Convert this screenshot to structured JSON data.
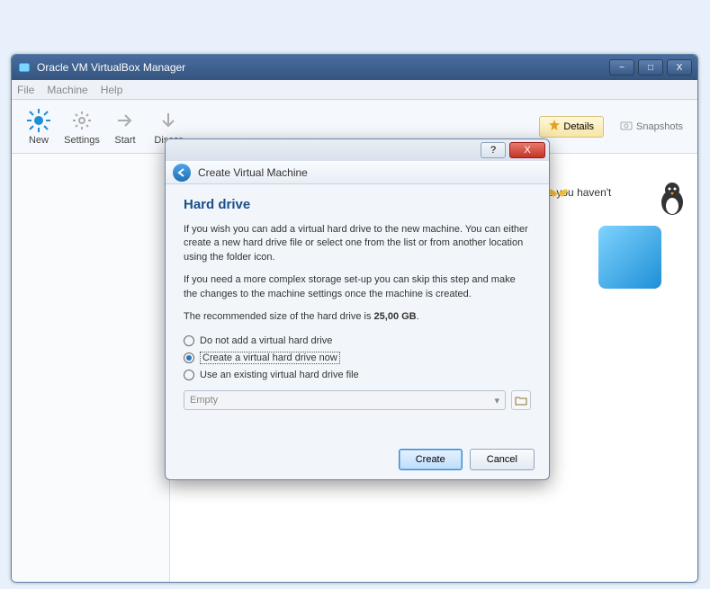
{
  "window": {
    "title": "Oracle VM VirtualBox Manager",
    "min_label": "−",
    "max_label": "□",
    "close_label": "X"
  },
  "menu": {
    "file": "File",
    "machine": "Machine",
    "help": "Help"
  },
  "toolbar": {
    "new_label": "New",
    "settings_label": "Settings",
    "start_label": "Start",
    "discard_label": "Discar",
    "details_label": "Details",
    "snapshots_label": "Snapshots"
  },
  "main": {
    "welcome_fragment": "y now because you haven't"
  },
  "modal": {
    "header_title": "Create Virtual Machine",
    "section_title": "Hard drive",
    "paragraph1": "If you wish you can add a virtual hard drive to the new machine. You can either create a new hard drive file or select one from the list or from another location using the folder icon.",
    "paragraph2": "If you need a more complex storage set-up you can skip this step and make the changes to the machine settings once the machine is created.",
    "recommend_prefix": "The recommended size of the hard drive is ",
    "recommend_size": "25,00 GB",
    "recommend_suffix": ".",
    "option_none": "Do not add a virtual hard drive",
    "option_create": "Create a virtual hard drive now",
    "option_existing": "Use an existing virtual hard drive file",
    "combo_value": "Empty",
    "btn_create": "Create",
    "btn_cancel": "Cancel",
    "help_label": "?",
    "close_label": "X"
  }
}
